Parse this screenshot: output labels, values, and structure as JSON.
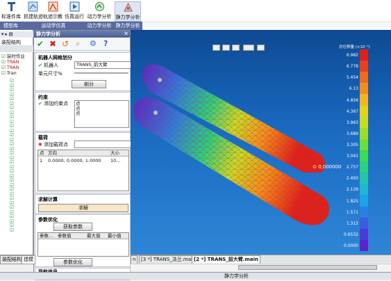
{
  "ribbon": {
    "buttons": [
      {
        "label": "标准件库",
        "color": "#2a5aa8"
      },
      {
        "label": "抓建轨迹",
        "color": "#3b7fd0"
      },
      {
        "label": "轨迹示教",
        "color": "#d04020"
      },
      {
        "label": "仿真运行",
        "color": "#2a6ab0"
      },
      {
        "label": "动力学分析",
        "color": "#2a8a3a"
      },
      {
        "label": "静力学分析",
        "color": "#c04030"
      }
    ],
    "groups": [
      "模型库",
      "运动学仿真",
      "动力学分析",
      "静力学分析"
    ]
  },
  "tree": {
    "title": "装配结构",
    "items": [
      "装时作业",
      "TRAN",
      "TRAN",
      "Tran"
    ]
  },
  "panel": {
    "title": "静力学分析",
    "mesh_section": "机器人网格划分",
    "robot_label": "机器人",
    "robot_value": "TRANS_前大臂",
    "unit_label": "单元尺寸%",
    "mesh_button": "剖分",
    "constraint_section": "约束",
    "add_constraint": "添加约束点",
    "constraint_points": [
      "点",
      "点",
      "点"
    ],
    "load_section": "载荷",
    "add_load": "添加载荷点",
    "load_headers": [
      "点",
      "方向",
      "大小"
    ],
    "load_row": [
      "1",
      "0.0000, 0.0000, 1.0000",
      "10..."
    ],
    "solve_section": "求解计算",
    "solve_button": "求解",
    "opt_section": "参数优化",
    "fetch_button": "获取参数",
    "opt_headers": [
      "参数...",
      "参数值",
      "最大值",
      "最小值"
    ],
    "opt_button": "参数优化",
    "nav_section": "导航信息",
    "nav_line": "求解计算"
  },
  "viewport": {
    "marker": "0,000000",
    "legend_title": "总位移量 (×10⁻³)",
    "legend_values": [
      "6.982",
      "6.778",
      "5.454",
      "6.13",
      "4.856",
      "4.367",
      "3.963",
      "3.689",
      "3.305",
      "3.041",
      "2.757",
      "2.493",
      "2.129",
      "1.825",
      "1.571",
      "1.313",
      "0.6532",
      "0.0000"
    ],
    "legend_colors": [
      "#e0201b",
      "#e8401b",
      "#ef6a1c",
      "#f38d1d",
      "#f6b31f",
      "#e6d022",
      "#c7dc26",
      "#9bdd2a",
      "#6ddf3a",
      "#3fd952",
      "#2cd07e",
      "#24c3aa",
      "#21b6d0",
      "#1fa2e6",
      "#2a7fe3",
      "#3a5cde",
      "#4a3bd6",
      "#5a24c8"
    ]
  },
  "doc_tabs": [
    "n",
    "[3 *] TRANS_法兰.main",
    "[2 *] TRANS_前大臂.main"
  ],
  "bottom_tabs": [
    "装配结构",
    "建模"
  ],
  "status": {
    "text": "静力学分析"
  },
  "colors": {
    "accent": "#5a6aa0",
    "viewport_bg": "#1a6ac2"
  }
}
